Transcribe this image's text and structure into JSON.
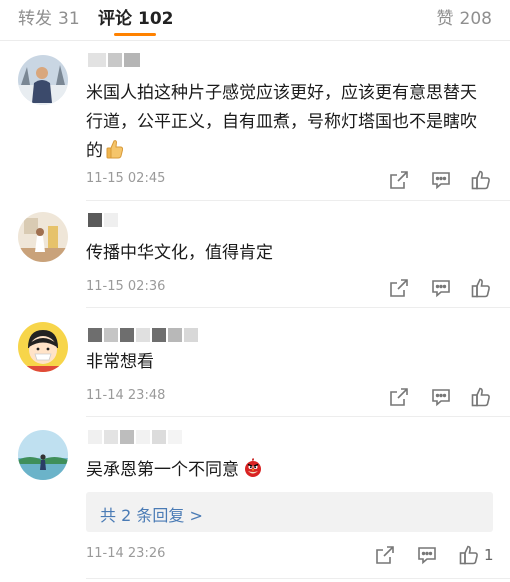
{
  "tabs": {
    "repost_label": "转发",
    "repost_count": "31",
    "comment_label": "评论",
    "comment_count": "102",
    "like_label": "赞",
    "like_count": "208"
  },
  "comments": [
    {
      "text": "米国人拍这种片子感觉应该更好，应该更有意思替天行道，公平正义，自有皿煮，号称灯塔国也不是瞎吹的",
      "emoji": "thumbs-up-icon",
      "time": "11-15 02:45"
    },
    {
      "text": "传播中华文化，值得肯定",
      "time": "11-15 02:36"
    },
    {
      "text": "非常想看",
      "time": "11-14 23:48"
    },
    {
      "text": "吴承恩第一个不同意",
      "emoji": "angry-bird-icon",
      "time": "11-14 23:26",
      "reply_link": "共 2 条回复 >",
      "like_count": "1"
    }
  ],
  "colors": {
    "accent": "#ff8200",
    "link": "#4a7bb5",
    "muted": "#9a9a9a"
  }
}
